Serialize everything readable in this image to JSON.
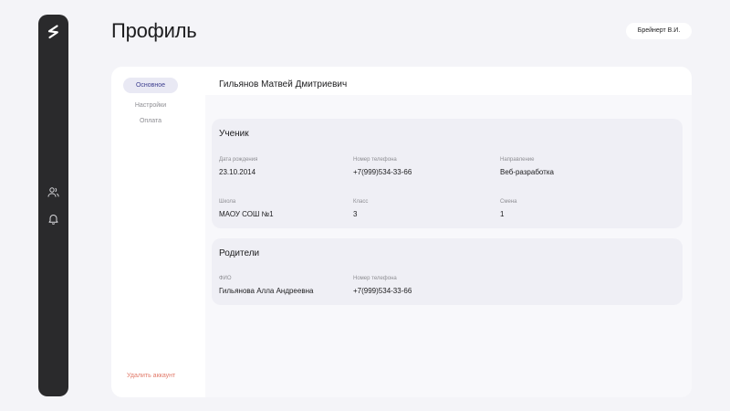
{
  "header": {
    "title": "Профиль",
    "user_chip": "Брейнерт В.И."
  },
  "sidebar": {
    "icons": [
      "logo-icon",
      "users-icon",
      "bell-icon"
    ]
  },
  "tabs": [
    {
      "label": "Основное",
      "active": true
    },
    {
      "label": "Настройки",
      "active": false
    },
    {
      "label": "Оплата",
      "active": false
    }
  ],
  "profile": {
    "full_name": "Гильянов Матвей Дмитриевич",
    "delete_label": "Удалить аккаунт"
  },
  "student": {
    "title": "Ученик",
    "fields": [
      {
        "label": "Дата рождения",
        "value": "23.10.2014"
      },
      {
        "label": "Номер телефона",
        "value": "+7(999)534-33-66"
      },
      {
        "label": "Направление",
        "value": "Веб-разработка"
      },
      {
        "label": "Школа",
        "value": "МАОУ СОШ №1"
      },
      {
        "label": "Класс",
        "value": "3"
      },
      {
        "label": "Смена",
        "value": "1"
      }
    ]
  },
  "parents": {
    "title": "Родители",
    "fields": [
      {
        "label": "ФИО",
        "value": "Гильянова Алла Андреевна"
      },
      {
        "label": "Номер телефона",
        "value": "+7(999)534-33-66"
      }
    ]
  },
  "colors": {
    "sidebar": "#2a2a2c",
    "active_tab_bg": "#e9e9f4",
    "active_tab_text": "#3e3f8f",
    "danger": "#e27b6b"
  }
}
